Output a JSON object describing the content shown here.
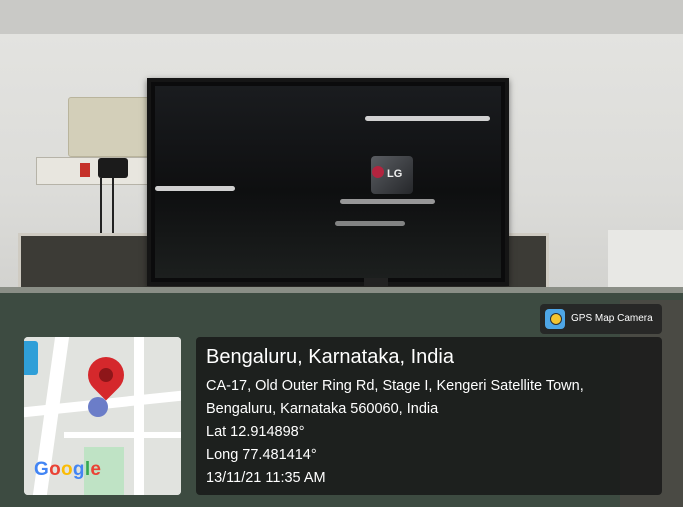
{
  "badge": {
    "label": "GPS Map Camera",
    "icon": "gps-map-camera-app-icon"
  },
  "location": {
    "title": "Bengaluru, Karnataka, India",
    "address_line1": "CA-17, Old Outer Ring Rd, Stage I, Kengeri Satellite Town,",
    "address_line2": "Bengaluru, Karnataka 560060, India",
    "latitude": "Lat 12.914898°",
    "longitude": "Long 77.481414°",
    "timestamp": "13/11/21 11:35 AM"
  },
  "map": {
    "brand": {
      "g1": "G",
      "o1": "o",
      "o2": "o",
      "g2": "g",
      "l": "l",
      "e": "e"
    },
    "pin_color": "#d5282c"
  },
  "tv": {
    "brand": "LG"
  },
  "colors": {
    "overlay": "#141414",
    "accent_blue": "#4ea6e6"
  }
}
